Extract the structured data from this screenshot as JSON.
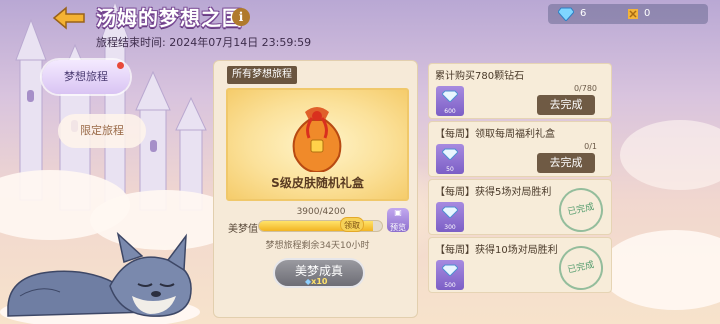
{
  "header": {
    "title": "汤姆的梦想之国",
    "deadline": "旅程结束时间: 2024年07月14日  23:59:59"
  },
  "currency": [
    {
      "icon": "diamond-icon",
      "value": "6"
    },
    {
      "icon": "gold-ticket-icon",
      "value": "0"
    }
  ],
  "tabs": [
    {
      "label": "梦想旅程",
      "active": true,
      "has_notification": true
    },
    {
      "label": "限定旅程",
      "active": false
    }
  ],
  "main": {
    "panel_label": "所有梦想旅程",
    "reward_name": "S级皮肤随机礼盒",
    "progress_text": "3900/4200",
    "progress_fraction": 0.93,
    "meter_label": "美梦值",
    "meter_tag": "领取",
    "preview_label": "预览",
    "remaining": "梦想旅程剩余34天10小时",
    "claim_label": "美梦成真",
    "claim_cost": "x10"
  },
  "tasks": [
    {
      "title": "累计购买780颗钻石",
      "reward_amount": "600",
      "count": "0/780",
      "button": "去完成",
      "completed": false
    },
    {
      "title": "【每周】领取每周福利礼盒",
      "reward_amount": "50",
      "count": "0/1",
      "button": "去完成",
      "completed": false
    },
    {
      "title": "【每周】获得5场对局胜利",
      "reward_amount": "300",
      "stamp": "已完成",
      "completed": true
    },
    {
      "title": "【每周】获得10场对局胜利",
      "reward_amount": "500",
      "stamp": "已完成",
      "completed": true
    }
  ]
}
